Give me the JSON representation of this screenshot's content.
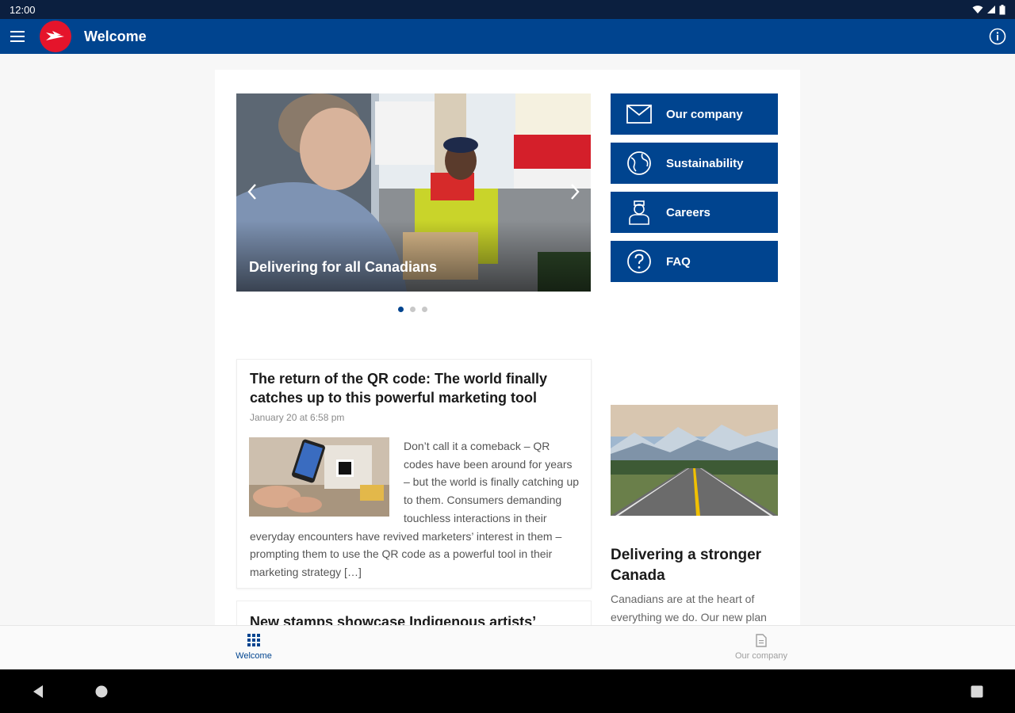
{
  "status_bar": {
    "time": "12:00",
    "icons": [
      "wifi-icon",
      "signal-icon",
      "battery-icon"
    ]
  },
  "app_bar": {
    "title": "Welcome",
    "menu_icon": "menu-icon",
    "info_icon": "info-icon"
  },
  "carousel": {
    "caption": "Delivering for all Canadians",
    "slide_count": 3,
    "active_index": 0
  },
  "tiles": [
    {
      "label": "Our company",
      "icon": "envelope-icon"
    },
    {
      "label": "Sustainability",
      "icon": "globe-icon"
    },
    {
      "label": "Careers",
      "icon": "person-icon"
    },
    {
      "label": "FAQ",
      "icon": "question-icon"
    }
  ],
  "articles": [
    {
      "title": "The return of the QR code: The world finally catches up to this powerful marketing tool",
      "date": "January 20 at 6:58 pm",
      "excerpt": "Don’t call it a comeback – QR codes have been around for years – but the world is finally catching up to them. Consumers demanding touchless interactions in their everyday encounters have revived marketers’ interest in them – prompting them to use the QR code as a powerful tool in their marketing strategy […]"
    },
    {
      "title": "New stamps showcase Indigenous artists’"
    }
  ],
  "feature": {
    "title": "Delivering a stronger Canada",
    "text": "Canadians are at the heart of everything we do. Our new plan"
  },
  "bottom_nav": [
    {
      "label": "Welcome",
      "icon": "grid-icon",
      "active": true
    },
    {
      "label": "Our company",
      "icon": "document-icon",
      "active": false
    }
  ],
  "colors": {
    "brand_blue": "#00448f",
    "brand_red": "#e5142b",
    "status_bar": "#0b1f3f"
  }
}
